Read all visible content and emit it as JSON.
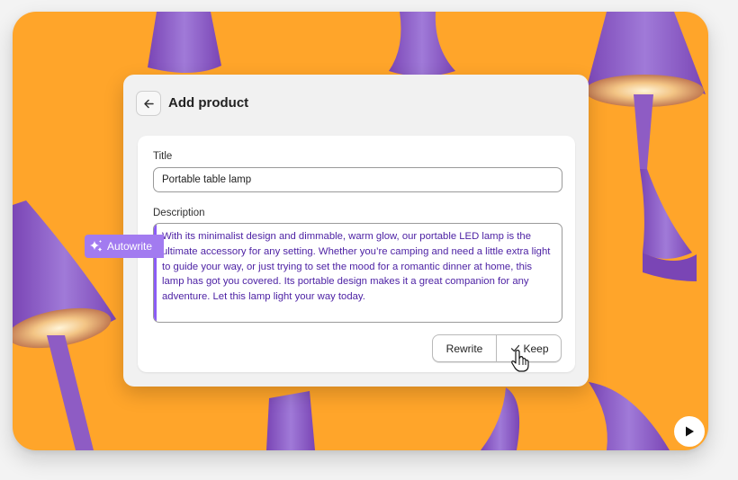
{
  "header": {
    "title": "Add product",
    "back_icon": "arrow-left-icon"
  },
  "form": {
    "title_label": "Title",
    "title_value": "Portable table lamp",
    "description_label": "Description",
    "description_value": "With its minimalist design and dimmable, warm glow, our portable LED lamp is the ultimate accessory for any setting. Whether you’re camping and need a little extra light to guide your way, or just trying to set the mood for a romantic dinner at home, this lamp has got you covered. Its portable design makes it a great companion for any adventure. Let this lamp light your way today."
  },
  "autowrite": {
    "label": "Autowrite",
    "icon": "sparkle-icon"
  },
  "actions": {
    "rewrite_label": "Rewrite",
    "keep_label": "Keep",
    "keep_icon": "checkmark-icon"
  },
  "media": {
    "play_icon": "play-icon"
  },
  "colors": {
    "background": "#ffa52a",
    "lamp_purple": "#8e5cc4",
    "accent": "#a27bf0",
    "generated_text": "#4b1fa3"
  }
}
